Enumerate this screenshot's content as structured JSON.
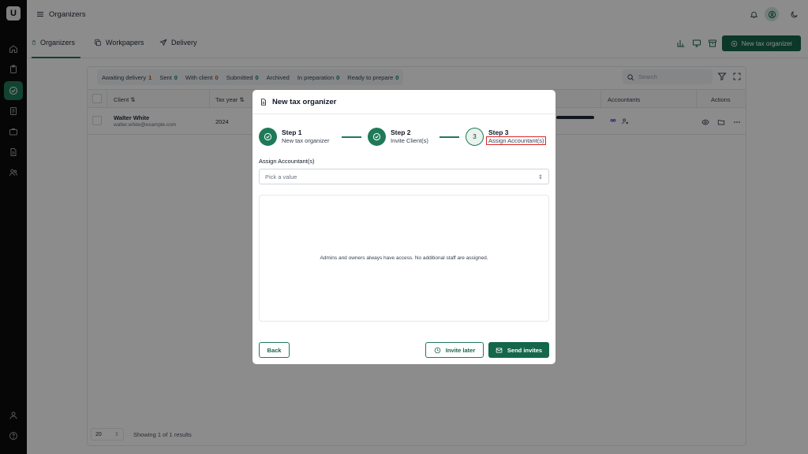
{
  "colors": {
    "brand": "#14674a",
    "brand_light": "#e8f3ee",
    "highlight": "#dc2626",
    "sidebar": "#0b0b0b"
  },
  "sidebar": {
    "logo": "U",
    "items": [
      {
        "icon": "home-icon"
      },
      {
        "icon": "clipboard-icon"
      },
      {
        "icon": "organizer-icon",
        "active": true
      },
      {
        "icon": "document-icon"
      },
      {
        "icon": "briefcase-icon"
      },
      {
        "icon": "file-icon"
      },
      {
        "icon": "users-icon"
      }
    ],
    "bottom": [
      {
        "icon": "user-icon"
      },
      {
        "icon": "help-icon"
      }
    ]
  },
  "header": {
    "title": "Organizers"
  },
  "subnav": {
    "tabs": [
      {
        "label": "Organizers",
        "icon": "clipboard-icon",
        "active": true
      },
      {
        "label": "Workpapers",
        "icon": "copy-icon"
      },
      {
        "label": "Delivery",
        "icon": "send-icon"
      }
    ],
    "new_button": "New tax organizer"
  },
  "filters": [
    {
      "label": "Awaiting delivery",
      "count": "1",
      "warn": true
    },
    {
      "label": "Sent",
      "count": "0"
    },
    {
      "label": "With client",
      "count": "0",
      "warn": true
    },
    {
      "label": "Submitted",
      "count": "0"
    },
    {
      "label": "Archived",
      "count": ""
    },
    {
      "label": "In preparation",
      "count": "0"
    },
    {
      "label": "Ready to prepare",
      "count": "0"
    }
  ],
  "search": {
    "placeholder": "Search"
  },
  "table": {
    "columns": {
      "client": "Client",
      "tax_year": "Tax year",
      "accountants": "Accountants",
      "actions": "Actions"
    },
    "rows": [
      {
        "name": "Walter White",
        "email": "walter.white@example.com",
        "tax_year": "2024"
      }
    ]
  },
  "pagination": {
    "page_size": "20",
    "info": "Showing 1 of 1 results"
  },
  "modal": {
    "title": "New tax organizer",
    "steps": [
      {
        "title": "Step 1",
        "subtitle": "New tax organizer",
        "status": "done"
      },
      {
        "title": "Step 2",
        "subtitle": "Invite Client(s)",
        "status": "done"
      },
      {
        "title": "Step 3",
        "subtitle": "Assign Accountant(s)",
        "status": "current",
        "number": "3"
      }
    ],
    "field_label": "Assign Accountant(s)",
    "select_placeholder": "Pick a value",
    "empty_message": "Admins and owners always have access. No additional staff are assigned.",
    "buttons": {
      "back": "Back",
      "invite_later": "Invite later",
      "send_invites": "Send invites"
    }
  }
}
